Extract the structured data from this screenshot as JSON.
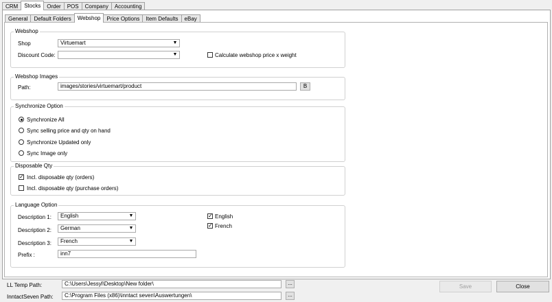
{
  "main_tabs": [
    "CRM",
    "Stocks",
    "Order",
    "POS",
    "Company",
    "Accounting"
  ],
  "sub_tabs": [
    "General",
    "Default Folders",
    "Webshop",
    "Price Options",
    "Item Defaults",
    "eBay"
  ],
  "webshop": {
    "title": "Webshop",
    "shop_label": "Shop",
    "shop_value": "Virtuemart",
    "discount_label": "Discount Code:",
    "discount_value": "",
    "calc_label": "Calculate webshop price x weight",
    "calc_checked": false
  },
  "webshop_images": {
    "title": "Webshop Images",
    "path_label": "Path:",
    "path_value": "images/stories/virtuemart/product",
    "browse_label": "B"
  },
  "sync": {
    "title": "Synchronize Option",
    "options": [
      "Synchronize All",
      "Sync selling price and qty on hand",
      "Synchronize Updated only",
      "Sync Image only"
    ],
    "selected": "Synchronize All"
  },
  "disposable": {
    "title": "Disposable Qty",
    "orders_label": "Incl. disposable qty (orders)",
    "orders_checked": true,
    "purchase_label": "Incl. disposable qty (purchase orders)",
    "purchase_checked": false
  },
  "language": {
    "title": "Language Option",
    "desc1_label": "Description 1:",
    "desc1_value": "English",
    "desc2_label": "Description 2:",
    "desc2_value": "German",
    "desc3_label": "Description 3:",
    "desc3_value": "French",
    "prefix_label": "Prefix :",
    "prefix_value": "inn7",
    "english_label": "English",
    "english_checked": true,
    "french_label": "French",
    "french_checked": true
  },
  "footer": {
    "ll_temp_label": "LL Temp Path:",
    "ll_temp_value": "C:\\Users\\Jessyl\\Desktop\\New folder\\",
    "inntact_label": "InntactSeven Path:",
    "inntact_value": "C:\\Program Files (x86)\\inntact seven\\Auswertungen\\",
    "browse_label": "...",
    "save_label": "Save",
    "close_label": "Close"
  }
}
